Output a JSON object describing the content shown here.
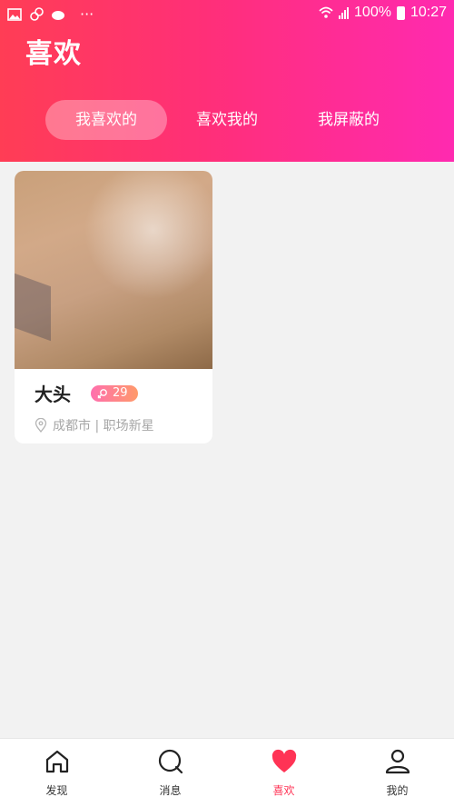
{
  "status_bar": {
    "battery": "100%",
    "time": "10:27",
    "dots": "···"
  },
  "header": {
    "title": "喜欢"
  },
  "tabs": [
    {
      "label": "我喜欢的",
      "active": true
    },
    {
      "label": "喜欢我的",
      "active": false
    },
    {
      "label": "我屏蔽的",
      "active": false
    }
  ],
  "cards": [
    {
      "name": "大头",
      "age": "29",
      "location": "成都市 | 职场新星"
    }
  ],
  "bottom_nav": [
    {
      "label": "发现",
      "icon": "home-icon",
      "active": false
    },
    {
      "label": "消息",
      "icon": "message-icon",
      "active": false
    },
    {
      "label": "喜欢",
      "icon": "heart-icon",
      "active": true
    },
    {
      "label": "我的",
      "icon": "profile-icon",
      "active": false
    }
  ],
  "colors": {
    "header_gradient_start": "#ff3d55",
    "header_gradient_end": "#ff2ab0",
    "accent": "#ff3355"
  }
}
